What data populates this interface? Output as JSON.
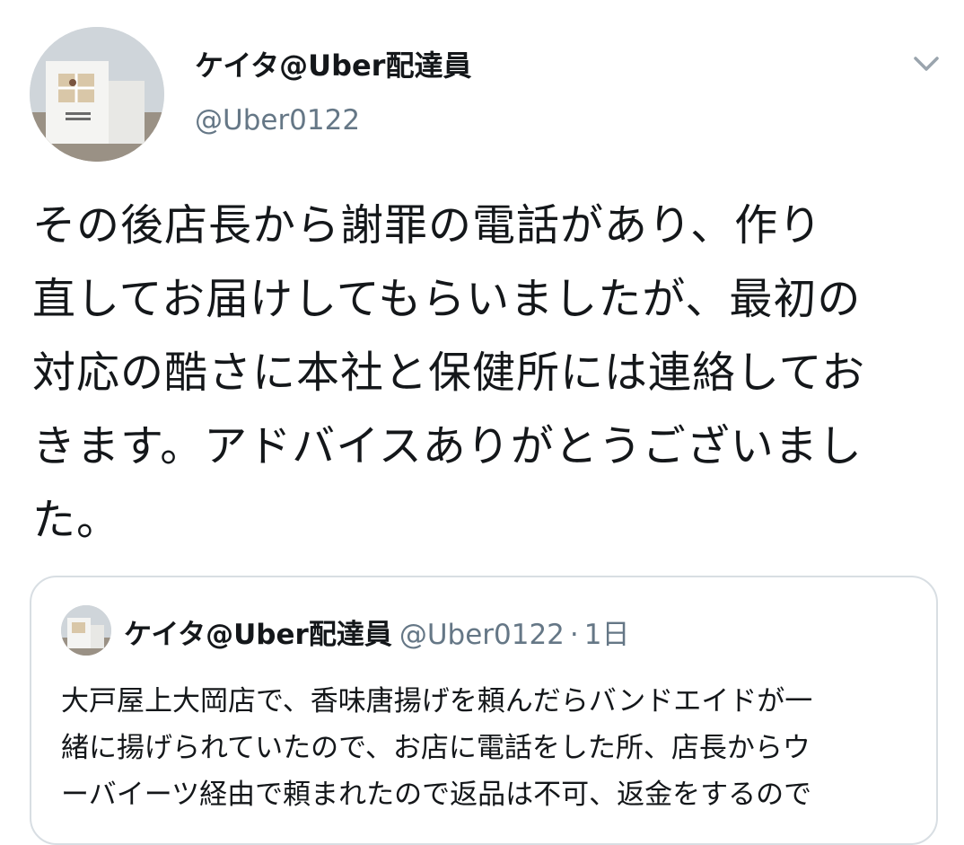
{
  "tweet": {
    "display_name": "ケイタ@Uber配達員",
    "handle": "@Uber0122",
    "menu_icon": "chevron-down-icon",
    "text_lines": [
      "その後店長から謝罪の電話があり、作り",
      "直してお届けしてもらいましたが、最初の",
      "対応の酷さに本社と保健所には連絡してお",
      "きます。アドバイスありがとうございまし",
      "た。"
    ]
  },
  "quoted_tweet": {
    "display_name": "ケイタ@Uber配達員",
    "handle": "@Uber0122",
    "separator": "·",
    "time": "1日",
    "text_lines": [
      "大戸屋上大岡店で、香味唐揚げを頼んだらバンドエイドが一",
      "緒に揚げられていたので、お店に電話をした所、店長からウ",
      "ーバイーツ経由で頼まれたので返品は不可、返金をするので"
    ]
  },
  "colors": {
    "text_primary": "#14171a",
    "text_secondary": "#657786",
    "border": "#d8dee3"
  }
}
